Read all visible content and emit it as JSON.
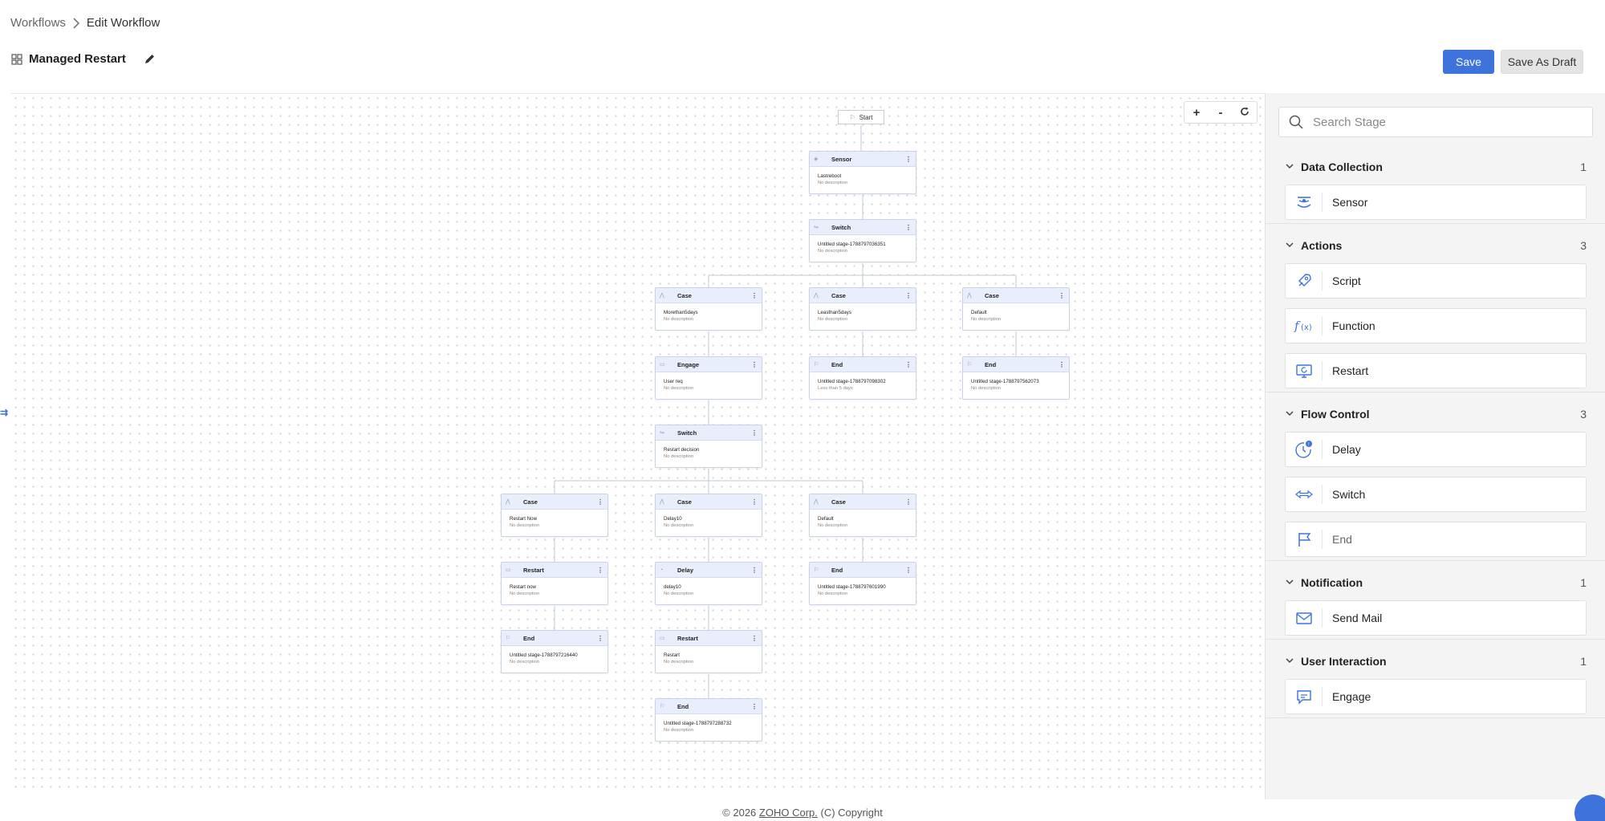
{
  "breadcrumb": {
    "parent": "Workflows",
    "current": "Edit Workflow"
  },
  "workflow": {
    "title": "Managed Restart"
  },
  "buttons": {
    "save": "Save",
    "save_draft": "Save As Draft"
  },
  "zoom": {
    "plus": "+",
    "minus": "-"
  },
  "canvas": {
    "start_label": "Start",
    "nodes": [
      {
        "type": "Sensor",
        "name": "Lastreboot",
        "desc": "No description",
        "icon": "sensor"
      },
      {
        "type": "Switch",
        "name": "Untitled stage-1788797036351",
        "desc": "No description",
        "icon": "switch"
      },
      {
        "type": "Case",
        "name": "Morethan5days",
        "desc": "No description",
        "icon": "case"
      },
      {
        "type": "Case",
        "name": "Leasthan5days",
        "desc": "No description",
        "icon": "case"
      },
      {
        "type": "Case",
        "name": "Default",
        "desc": "No description",
        "icon": "case"
      },
      {
        "type": "Engage",
        "name": "User req",
        "desc": "No description",
        "icon": "engage"
      },
      {
        "type": "End",
        "name": "Untitled stage-1788797098302",
        "desc": "Less than 5 days",
        "icon": "end"
      },
      {
        "type": "End",
        "name": "Untitled stage-1788797562073",
        "desc": "No description",
        "icon": "end"
      },
      {
        "type": "Switch",
        "name": "Restart decision",
        "desc": "No description",
        "icon": "switch"
      },
      {
        "type": "Case",
        "name": "Restart Now",
        "desc": "No description",
        "icon": "case"
      },
      {
        "type": "Case",
        "name": "Delay10",
        "desc": "No description",
        "icon": "case"
      },
      {
        "type": "Case",
        "name": "Default",
        "desc": "No description",
        "icon": "case"
      },
      {
        "type": "Restart",
        "name": "Restart now",
        "desc": "No description",
        "icon": "restart"
      },
      {
        "type": "Delay",
        "name": "delay10",
        "desc": "No description",
        "icon": "delay"
      },
      {
        "type": "End",
        "name": "Untitled stage-1788797601990",
        "desc": "No description",
        "icon": "end"
      },
      {
        "type": "End",
        "name": "Untitled stage-1788797216440",
        "desc": "No description",
        "icon": "end"
      },
      {
        "type": "Restart",
        "name": "Restart",
        "desc": "No description",
        "icon": "restart"
      },
      {
        "type": "End",
        "name": "Untitled stage-1788797288732",
        "desc": "No description",
        "icon": "end"
      }
    ]
  },
  "panel": {
    "search_placeholder": "Search Stage",
    "sections": [
      {
        "title": "Data Collection",
        "count": "1",
        "items": [
          {
            "label": "Sensor",
            "icon": "sensor-icon"
          }
        ]
      },
      {
        "title": "Actions",
        "count": "3",
        "items": [
          {
            "label": "Script",
            "icon": "rocket-icon"
          },
          {
            "label": "Function",
            "icon": "function-icon"
          },
          {
            "label": "Restart",
            "icon": "monitor-restart-icon"
          }
        ]
      },
      {
        "title": "Flow Control",
        "count": "3",
        "items": [
          {
            "label": "Delay",
            "icon": "clock-icon"
          },
          {
            "label": "Switch",
            "icon": "switch-arrows-icon"
          },
          {
            "label": "End",
            "icon": "flag-icon"
          }
        ]
      },
      {
        "title": "Notification",
        "count": "1",
        "items": [
          {
            "label": "Send Mail",
            "icon": "mail-icon"
          }
        ]
      },
      {
        "title": "User Interaction",
        "count": "1",
        "items": [
          {
            "label": "Engage",
            "icon": "chat-icon"
          }
        ]
      }
    ]
  },
  "footer": {
    "prefix": "© 2026",
    "company": "ZOHO Corp.",
    "suffix": "(C) Copyright"
  },
  "colors": {
    "primary": "#3d73db",
    "node_header": "#e8eefb",
    "panel_bg": "#f4f4f4"
  }
}
